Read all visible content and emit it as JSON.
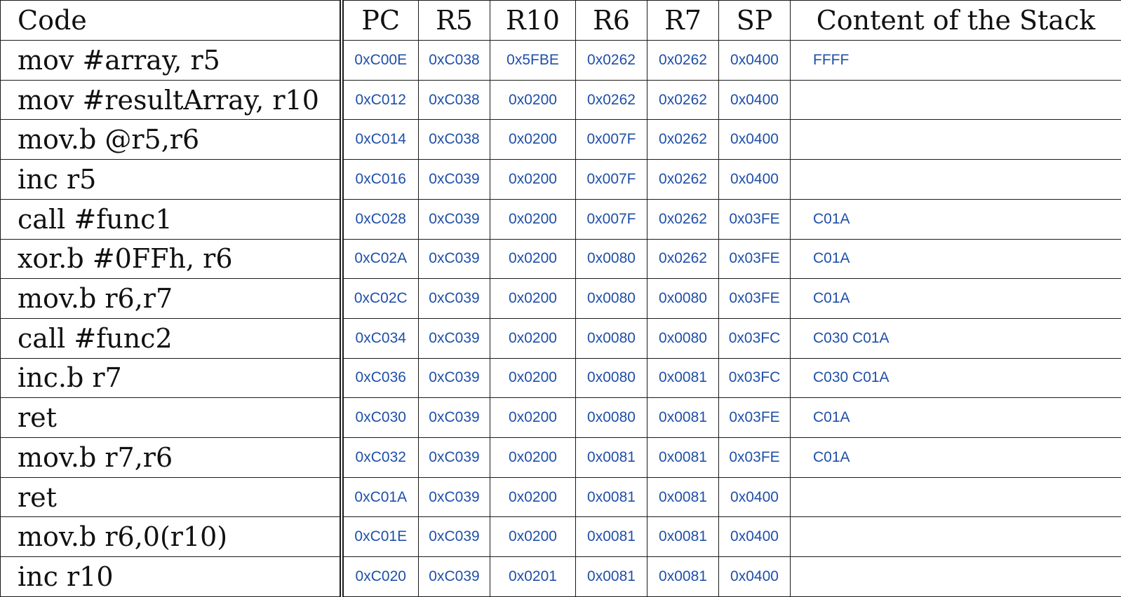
{
  "table": {
    "headers": {
      "code": "Code",
      "pc": "PC",
      "r5": "R5",
      "r10": "R10",
      "r6": "R6",
      "r7": "R7",
      "sp": "SP",
      "stack": "Content of the Stack"
    },
    "rows": [
      {
        "code": "mov #array, r5",
        "pc": "0xC00E",
        "r5": "0xC038",
        "r10": "0x5FBE",
        "r6": "0x0262",
        "r7": "0x0262",
        "sp": "0x0400",
        "stack": "FFFF"
      },
      {
        "code": "mov #resultArray, r10",
        "pc": "0xC012",
        "r5": "0xC038",
        "r10": "0x0200",
        "r6": "0x0262",
        "r7": "0x0262",
        "sp": "0x0400",
        "stack": ""
      },
      {
        "code": "mov.b @r5,r6",
        "pc": "0xC014",
        "r5": "0xC038",
        "r10": "0x0200",
        "r6": "0x007F",
        "r7": "0x0262",
        "sp": "0x0400",
        "stack": ""
      },
      {
        "code": "inc r5",
        "pc": "0xC016",
        "r5": "0xC039",
        "r10": "0x0200",
        "r6": "0x007F",
        "r7": "0x0262",
        "sp": "0x0400",
        "stack": ""
      },
      {
        "code": "call #func1",
        "pc": "0xC028",
        "r5": "0xC039",
        "r10": "0x0200",
        "r6": "0x007F",
        "r7": "0x0262",
        "sp": "0x03FE",
        "stack": "C01A"
      },
      {
        "code": "xor.b #0FFh, r6",
        "pc": "0xC02A",
        "r5": "0xC039",
        "r10": "0x0200",
        "r6": "0x0080",
        "r7": "0x0262",
        "sp": "0x03FE",
        "stack": "C01A"
      },
      {
        "code": "mov.b r6,r7",
        "pc": "0xC02C",
        "r5": "0xC039",
        "r10": "0x0200",
        "r6": "0x0080",
        "r7": "0x0080",
        "sp": "0x03FE",
        "stack": "C01A"
      },
      {
        "code": "call #func2",
        "pc": "0xC034",
        "r5": "0xC039",
        "r10": "0x0200",
        "r6": "0x0080",
        "r7": "0x0080",
        "sp": "0x03FC",
        "stack": "C030 C01A"
      },
      {
        "code": "inc.b r7",
        "pc": "0xC036",
        "r5": "0xC039",
        "r10": "0x0200",
        "r6": "0x0080",
        "r7": "0x0081",
        "sp": "0x03FC",
        "stack": "C030 C01A"
      },
      {
        "code": "ret",
        "pc": "0xC030",
        "r5": "0xC039",
        "r10": "0x0200",
        "r6": "0x0080",
        "r7": "0x0081",
        "sp": "0x03FE",
        "stack": "C01A"
      },
      {
        "code": "mov.b r7,r6",
        "pc": "0xC032",
        "r5": "0xC039",
        "r10": "0x0200",
        "r6": "0x0081",
        "r7": "0x0081",
        "sp": "0x03FE",
        "stack": "C01A"
      },
      {
        "code": "ret",
        "pc": "0xC01A",
        "r5": "0xC039",
        "r10": "0x0200",
        "r6": "0x0081",
        "r7": "0x0081",
        "sp": "0x0400",
        "stack": ""
      },
      {
        "code": "mov.b r6,0(r10)",
        "pc": "0xC01E",
        "r5": "0xC039",
        "r10": "0x0200",
        "r6": "0x0081",
        "r7": "0x0081",
        "sp": "0x0400",
        "stack": ""
      },
      {
        "code": "inc r10",
        "pc": "0xC020",
        "r5": "0xC039",
        "r10": "0x0201",
        "r6": "0x0081",
        "r7": "0x0081",
        "sp": "0x0400",
        "stack": ""
      }
    ]
  },
  "colors": {
    "value_text": "#1f4fa8",
    "code_text": "#111111",
    "grid_line": "#1a1a1a"
  }
}
